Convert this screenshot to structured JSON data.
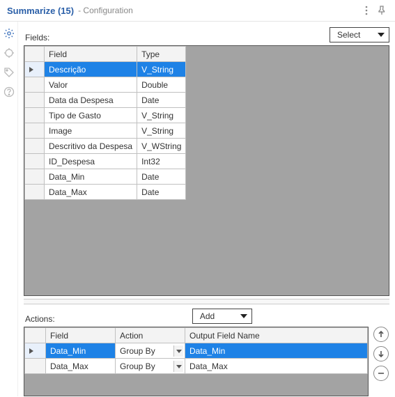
{
  "title": {
    "main": "Summarize (15)",
    "sub": "- Configuration"
  },
  "fields": {
    "label": "Fields:",
    "select_button": "Select",
    "columns": [
      "Field",
      "Type"
    ],
    "rows": [
      {
        "field": "Descrição",
        "type": "V_String",
        "selected": true
      },
      {
        "field": "Valor",
        "type": "Double",
        "selected": false
      },
      {
        "field": "Data da Despesa",
        "type": "Date",
        "selected": false
      },
      {
        "field": "Tipo de Gasto",
        "type": "V_String",
        "selected": false
      },
      {
        "field": "Image",
        "type": "V_String",
        "selected": false
      },
      {
        "field": "Descritivo da Despesa",
        "type": "V_WString",
        "selected": false
      },
      {
        "field": "ID_Despesa",
        "type": "Int32",
        "selected": false
      },
      {
        "field": "Data_Min",
        "type": "Date",
        "selected": false
      },
      {
        "field": "Data_Max",
        "type": "Date",
        "selected": false
      }
    ]
  },
  "actions": {
    "label": "Actions:",
    "add_button": "Add",
    "columns": [
      "Field",
      "Action",
      "Output Field Name"
    ],
    "rows": [
      {
        "field": "Data_Min",
        "action": "Group By",
        "output": "Data_Min",
        "selected": true
      },
      {
        "field": "Data_Max",
        "action": "Group By",
        "output": "Data_Max",
        "selected": false
      }
    ]
  }
}
